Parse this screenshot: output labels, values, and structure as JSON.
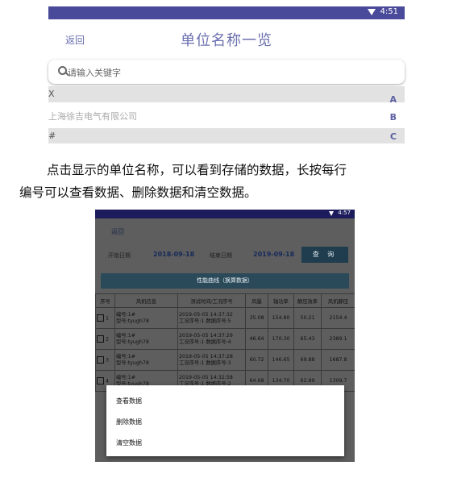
{
  "screen1": {
    "status": {
      "time": "4:51"
    },
    "header": {
      "back": "返回",
      "title": "单位名称一览"
    },
    "search": {
      "placeholder": "请输入关键字"
    },
    "list": [
      {
        "text": "X",
        "type": "section"
      },
      {
        "text": "上海徐吉电气有限公司",
        "type": "item"
      },
      {
        "text": "#",
        "type": "section"
      }
    ],
    "index_bar": [
      "A",
      "B",
      "C"
    ]
  },
  "caption": {
    "line1": "点击显示的单位名称，可以看到存储的数据，长按每行",
    "line2": "编号可以查看数据、删除数据和清空数据。"
  },
  "screen2": {
    "status": {
      "time": "4:57"
    },
    "back": "返回",
    "start_label": "开始日期",
    "start_date": "2018-09-18",
    "end_label": "结束日期",
    "end_date": "2019-09-18",
    "query": "查 询",
    "curve_button": "性能曲线（换算数据）",
    "table": {
      "headers": [
        "序号",
        "风机信息",
        "测试时间/工况序号",
        "风量",
        "轴功率",
        "静压效率",
        "风机静压"
      ],
      "rows": [
        {
          "no": "1",
          "info1": "编号:1#",
          "info2": "型号:tyugh78",
          "time1": "2019-05-05 14:37:32",
          "time2": "工况序号:1 数据序号:5",
          "flow": "35.08",
          "power": "154.80",
          "eff": "50.21",
          "pressure": "2154.4"
        },
        {
          "no": "2",
          "info1": "编号:1#",
          "info2": "型号:tyugh78",
          "time1": "2019-05-05 14:37:29",
          "time2": "工况序号:1 数据序号:4",
          "flow": "46.64",
          "power": "170.30",
          "eff": "65.43",
          "pressure": "2389.1"
        },
        {
          "no": "3",
          "info1": "编号:1#",
          "info2": "型号:tyugh78",
          "time1": "2019-05-05 14:37:28",
          "time2": "工况序号:1 数据序号:3",
          "flow": "60.72",
          "power": "146.65",
          "eff": "69.88",
          "pressure": "1687.8"
        },
        {
          "no": "4",
          "info1": "编号:1#",
          "info2": "型号:tyugh78",
          "time1": "2019-05-05 14:32:58",
          "time2": "工况序号:1 数据序号:2",
          "flow": "64.68",
          "power": "134.70",
          "eff": "62.89",
          "pressure": "1309.7"
        }
      ]
    },
    "menu": [
      "查看数据",
      "删除数据",
      "清空数据"
    ]
  }
}
